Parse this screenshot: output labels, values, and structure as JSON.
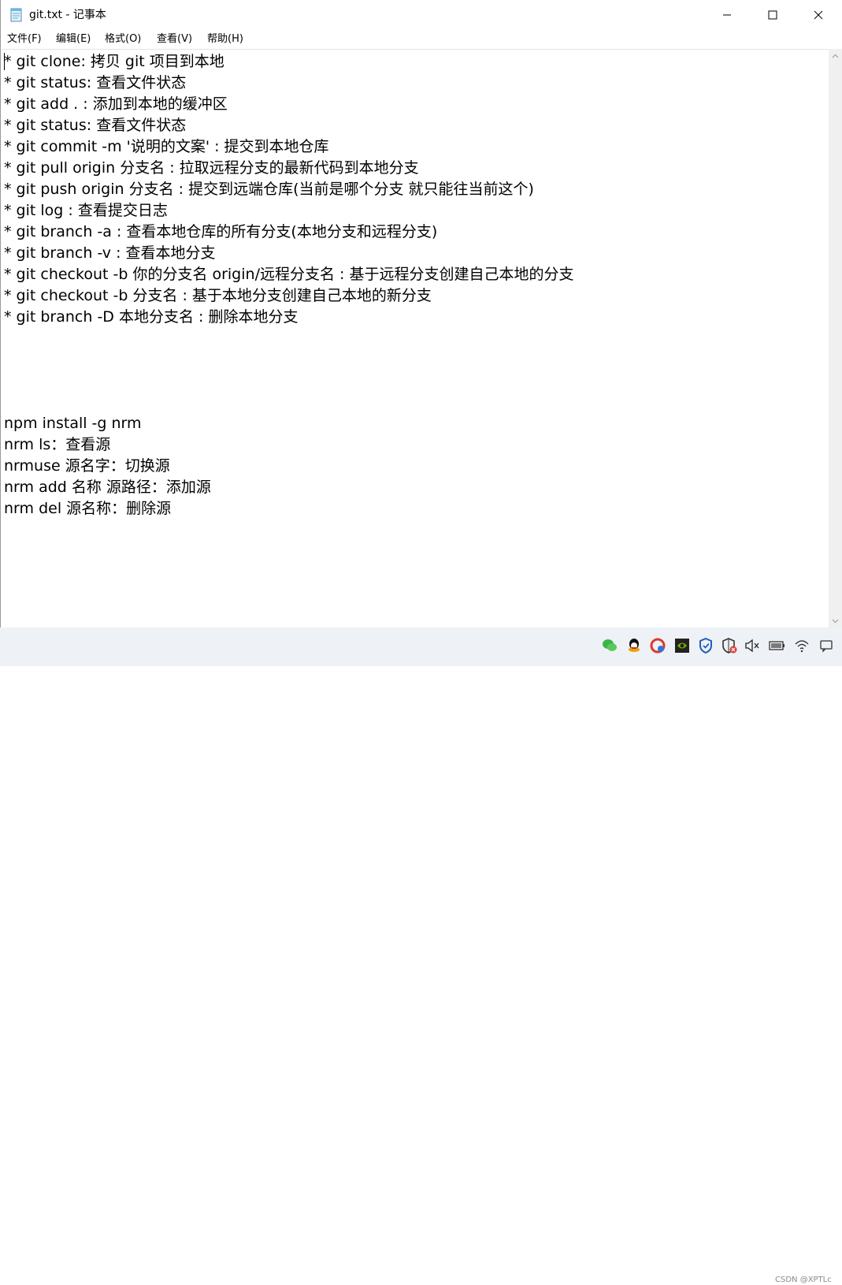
{
  "window": {
    "title": "git.txt - 记事本",
    "icon": "notepad-icon",
    "controls": [
      "minimize-icon",
      "maximize-icon",
      "close-icon"
    ]
  },
  "menu": {
    "file": "文件(F)",
    "edit": "编辑(E)",
    "format": "格式(O)",
    "view": "查看(V)",
    "help": "帮助(H)"
  },
  "document": {
    "lines": [
      "* git clone: 拷贝 git 项目到本地",
      "* git status: 查看文件状态",
      "* git add . : 添加到本地的缓冲区",
      "* git status: 查看文件状态",
      "* git commit -m '说明的文案' : 提交到本地仓库",
      "* git pull origin 分支名 : 拉取远程分支的最新代码到本地分支",
      "* git push origin 分支名 : 提交到远端仓库(当前是哪个分支 就只能往当前这个)",
      "* git log : 查看提交日志",
      "* git branch -a : 查看本地仓库的所有分支(本地分支和远程分支)",
      "* git branch -v : 查看本地分支",
      "* git checkout -b 你的分支名 origin/远程分支名 : 基于远程分支创建自己本地的分支",
      "* git checkout -b 分支名 : 基于本地分支创建自己本地的新分支",
      "* git branch -D 本地分支名 : 删除本地分支",
      "",
      "",
      "",
      "",
      "npm install -g nrm",
      "nrm ls：查看源",
      "nrmuse 源名字：切换源",
      "nrm add 名称 源路径：添加源",
      "nrm del 源名称：删除源"
    ]
  },
  "taskbar": {
    "tray_icons": [
      "wechat-icon",
      "qq-icon",
      "security-app-icon",
      "nvidia-icon",
      "defender-shield-icon",
      "security-alert-icon",
      "speaker-muted-icon",
      "battery-icon",
      "wifi-icon",
      "notification-icon"
    ],
    "watermark": "CSDN @XPTLc"
  }
}
